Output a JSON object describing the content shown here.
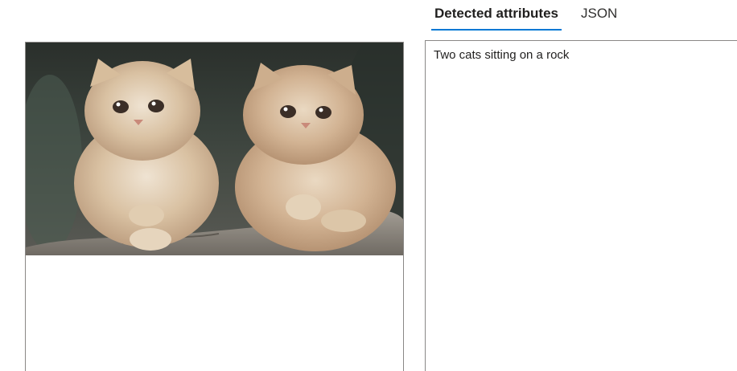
{
  "tabs": [
    {
      "label": "Detected attributes",
      "active": true
    },
    {
      "label": "JSON",
      "active": false
    }
  ],
  "results": {
    "caption": "Two cats sitting on a rock"
  },
  "image": {
    "subject": "two fluffy cream Persian kittens on a rock"
  },
  "colors": {
    "accent": "#0078d4",
    "border": "#8a8886"
  }
}
